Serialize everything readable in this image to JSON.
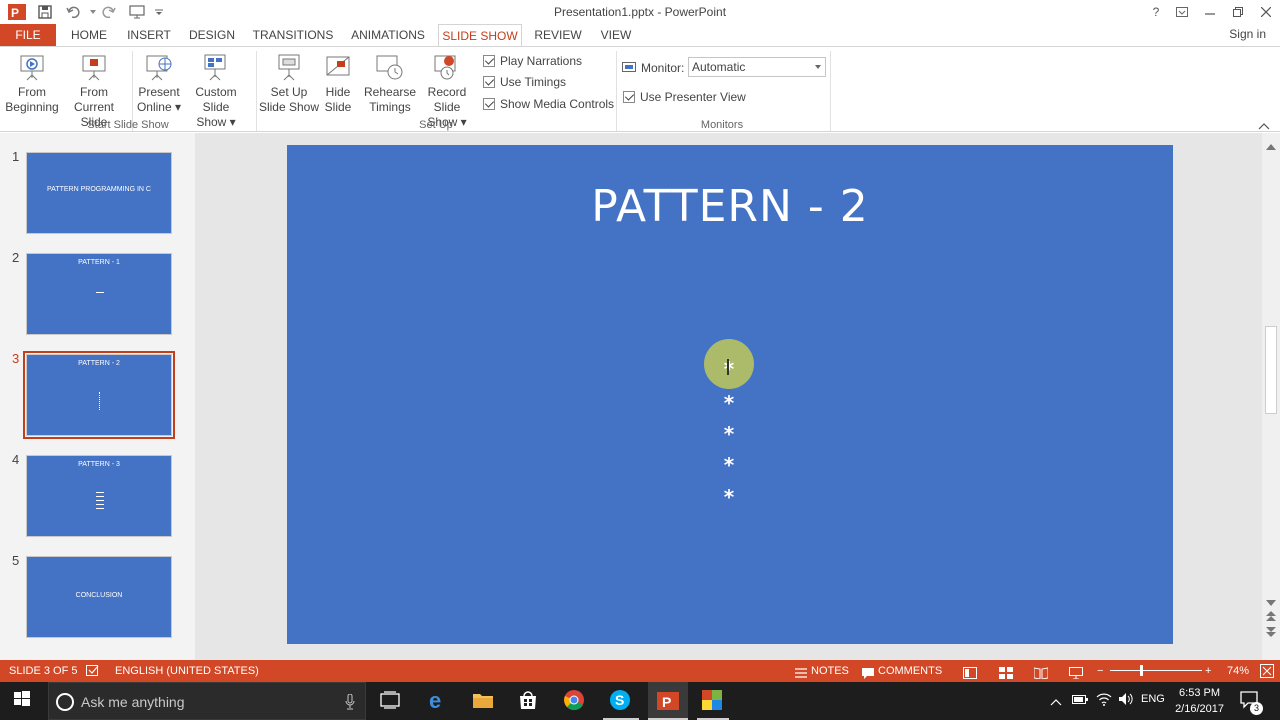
{
  "window": {
    "title": "Presentation1.pptx - PowerPoint",
    "help": "?",
    "sign_in": "Sign in"
  },
  "tabs": [
    {
      "label": "FILE"
    },
    {
      "label": "HOME"
    },
    {
      "label": "INSERT"
    },
    {
      "label": "DESIGN"
    },
    {
      "label": "TRANSITIONS"
    },
    {
      "label": "ANIMATIONS"
    },
    {
      "label": "SLIDE SHOW",
      "active": true
    },
    {
      "label": "REVIEW"
    },
    {
      "label": "VIEW"
    }
  ],
  "ribbon": {
    "start_group": {
      "label": "Start Slide Show",
      "from_beginning": [
        "From",
        "Beginning"
      ],
      "from_current": [
        "From",
        "Current Slide"
      ],
      "present_online": [
        "Present",
        "Online ▾"
      ],
      "custom_show": [
        "Custom Slide",
        "Show ▾"
      ]
    },
    "setup_group": {
      "label": "Set Up",
      "setup_show": [
        "Set Up",
        "Slide Show"
      ],
      "hide_slide": [
        "Hide",
        "Slide"
      ],
      "rehearse": [
        "Rehearse",
        "Timings"
      ],
      "record": [
        "Record Slide",
        "Show ▾"
      ],
      "play_narrations": "Play Narrations",
      "use_timings": "Use Timings",
      "show_media_controls": "Show Media Controls"
    },
    "monitors_group": {
      "label": "Monitors",
      "monitor_label": "Monitor:",
      "monitor_value": "Automatic",
      "use_presenter_view": "Use Presenter View"
    }
  },
  "thumbnails": [
    {
      "num": "1",
      "title": "PATTERN PROGRAMMING IN C"
    },
    {
      "num": "2",
      "title": "PATTERN - 1"
    },
    {
      "num": "3",
      "title": "PATTERN - 2"
    },
    {
      "num": "4",
      "title": "PATTERN - 3"
    },
    {
      "num": "5",
      "title": "CONCLUSION"
    }
  ],
  "slide": {
    "title": "PATTERN - 2",
    "stars": [
      "*",
      "*",
      "*",
      "*",
      "*"
    ]
  },
  "status": {
    "slide_info": "SLIDE 3 OF 5",
    "language": "ENGLISH (UNITED STATES)",
    "notes": "NOTES",
    "comments": "COMMENTS",
    "zoom": "74%"
  },
  "taskbar": {
    "search_placeholder": "Ask me anything",
    "lang": "ENG",
    "time": "6:53 PM",
    "date": "2/16/2017",
    "notification_count": "3"
  },
  "colors": {
    "accent": "#d24726",
    "slide_bg": "#4472c4"
  }
}
